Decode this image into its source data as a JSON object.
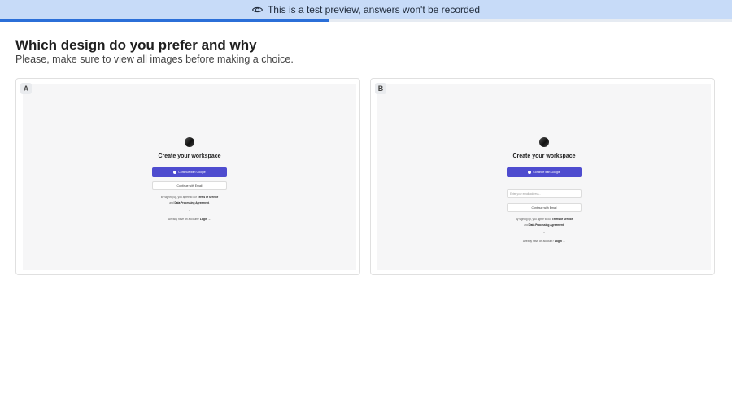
{
  "banner": {
    "icon": "eye-icon",
    "text": "This is a test preview, answers won't be recorded",
    "background": "#c7dbf8"
  },
  "progress": {
    "fraction": 0.45,
    "color": "#2b6fd8"
  },
  "question": {
    "title": "Which design do you prefer and why",
    "subtitle": "Please, make sure to view all images before making a choice."
  },
  "options": [
    {
      "label": "A",
      "preview": {
        "title": "Create your workspace",
        "google_button": "Continue with Google",
        "email_button": "Continue with Email",
        "terms_prefix": "By signing up, you agree to our",
        "terms_link": "Terms of Service",
        "terms_and": "and",
        "dpa_link": "Data Processing Agreement",
        "terms_end": ".",
        "dash": "–",
        "login_prefix": "Already have an account?",
        "login_link": "Login →"
      }
    },
    {
      "label": "B",
      "preview": {
        "title": "Create your workspace",
        "google_button": "Continue with Google",
        "email_placeholder": "Enter your email address...",
        "email_button": "Continue with Email",
        "terms_prefix": "By signing up, you agree to our",
        "terms_link": "Terms of Service",
        "terms_and": "and",
        "dpa_link": "Data Processing Agreement",
        "terms_end": ".",
        "dash": "–",
        "login_prefix": "Already have an account?",
        "login_link": "Login →"
      }
    }
  ]
}
